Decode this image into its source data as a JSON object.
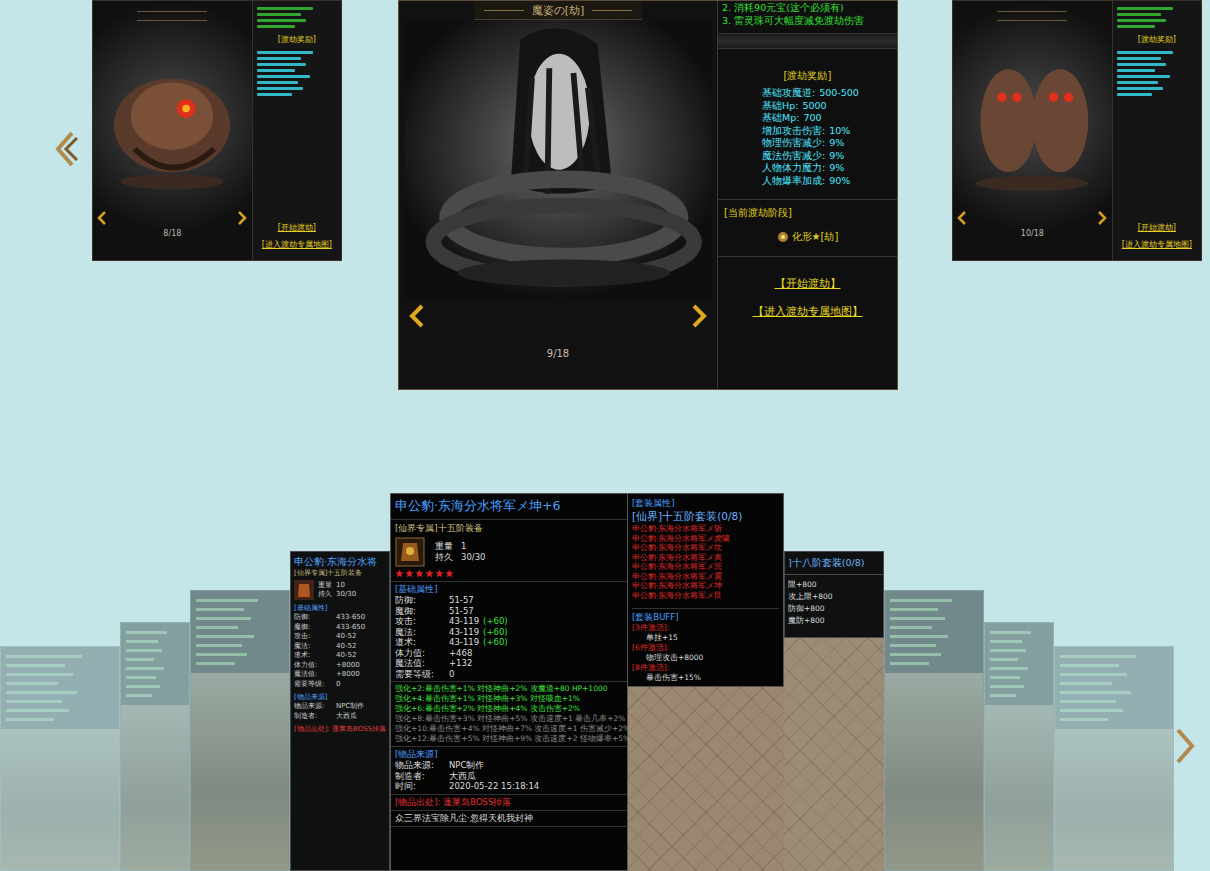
{
  "top_carousel": {
    "left_card": {
      "selected": false,
      "page": "8/18",
      "reward_title": "[渡劫奖励]",
      "buttons": [
        "[开始渡劫]",
        "[进入渡劫专属地图]"
      ]
    },
    "main_card": {
      "selected": true,
      "title": "魔姿の[劫]",
      "page": "9/18",
      "notes": [
        "2. 消耗90元宝(这个必须有)",
        "3. 雷灵珠可大幅度减免渡劫伤害"
      ],
      "reward_title": "[渡劫奖励]",
      "rewards": [
        {
          "label": "基础攻魔道:",
          "value": "500-500"
        },
        {
          "label": "基础Hp:",
          "value": "5000"
        },
        {
          "label": "基础Mp:",
          "value": "700"
        },
        {
          "label": "增加攻击伤害:",
          "value": "10%"
        },
        {
          "label": "物理伤害减少:",
          "value": "9%"
        },
        {
          "label": "魔法伤害减少:",
          "value": "9%"
        },
        {
          "label": "人物体力魔力:",
          "value": "9%"
        },
        {
          "label": "人物爆率加成:",
          "value": "90%"
        }
      ],
      "stage_title": "[当前渡劫阶段]",
      "stage": "化形★[劫]",
      "buttons": [
        "【开始渡劫】",
        "【进入渡劫专属地图】"
      ]
    },
    "right_card": {
      "selected": false,
      "page": "10/18",
      "reward_title": "[渡劫奖励]",
      "buttons": [
        "[开始渡劫]",
        "[进入渡劫专属地图]"
      ]
    }
  },
  "bottom_carousel": {
    "cards": [
      {
        "kind": "ghost",
        "selected": false
      },
      {
        "kind": "ghost",
        "selected": false
      },
      {
        "kind": "ghost",
        "selected": false
      },
      {
        "kind": "item",
        "selected": false,
        "title": "申公豹·东海分水将",
        "tier": "[仙界专属]十五阶装备",
        "meta": [
          {
            "label": "重量",
            "value": "10"
          },
          {
            "label": "持久",
            "value": "30/30"
          }
        ],
        "base_title": "[基础属性]",
        "base": [
          {
            "label": "防御:",
            "value": "433-650"
          },
          {
            "label": "魔御:",
            "value": "433-650"
          },
          {
            "label": "攻击:",
            "value": "40-52"
          },
          {
            "label": "魔法:",
            "value": "40-52"
          },
          {
            "label": "道术:",
            "value": "40-52"
          },
          {
            "label": "体力值:",
            "value": "+8000"
          },
          {
            "label": "魔法值:",
            "value": "+8000"
          },
          {
            "label": "需要等级:",
            "value": "0"
          }
        ],
        "source_title": "[物品来源]",
        "source": [
          {
            "label": "物品来源:",
            "value": "NPC制作"
          },
          {
            "label": "制造者:",
            "value": "大西瓜"
          }
        ],
        "origin": "[物品出处]: 蓬莱岛BOSS掉落"
      },
      {
        "kind": "main",
        "selected": true,
        "title": "申公豹·东海分水将军メ坤+6",
        "tier": "[仙界专属]十五阶装备",
        "meta": [
          {
            "label": "重量",
            "value": "1"
          },
          {
            "label": "持久",
            "value": "30/30"
          }
        ],
        "stars": 6,
        "base_title": "[基础属性]",
        "base": [
          {
            "label": "防御:",
            "value": "51-57"
          },
          {
            "label": "魔御:",
            "value": "51-57"
          },
          {
            "label": "攻击:",
            "value": "43-119",
            "bonus": "(+60)"
          },
          {
            "label": "魔法:",
            "value": "43-119",
            "bonus": "(+60)"
          },
          {
            "label": "道术:",
            "value": "43-119",
            "bonus": "(+60)"
          },
          {
            "label": "体力值:",
            "value": "+468"
          },
          {
            "label": "魔法值:",
            "value": "+132"
          },
          {
            "label": "需要等级:",
            "value": "0"
          }
        ],
        "enhance": [
          {
            "text": "强化+2:暴击伤害+1% 对怪神曲+2% 攻魔道+80 HP+1000",
            "active": true
          },
          {
            "text": "强化+4:暴击伤害+1% 对怪神曲+3% 对怪吸血+1%",
            "active": true
          },
          {
            "text": "强化+6:暴击伤害+2% 对怪神曲+4% 攻击伤害+2%",
            "active": true
          },
          {
            "text": "强化+8:暴击伤害+3% 对怪神曲+5% 攻击速度+1 暴击几率+2%",
            "active": false
          },
          {
            "text": "强化+10:暴击伤害+4% 对怪神曲+7% 攻击速度+1 伤害减少+2%",
            "active": false
          },
          {
            "text": "强化+12:暴击伤害+5% 对怪神曲+9% 攻击速度+2 怪物爆率+5%",
            "active": false
          }
        ],
        "source_title": "[物品来源]",
        "source": [
          {
            "label": "物品来源:",
            "value": "NPC制作"
          },
          {
            "label": "制造者:",
            "value": "大西瓜"
          },
          {
            "label": "时间:",
            "value": "2020-05-22 15:18:14"
          }
        ],
        "origin": "[物品出处]: 蓬莱岛BOSS掉落",
        "motto": "众三界法宝除凡尘·忽得天机我封神",
        "set": {
          "header": "[套装属性]",
          "title": "[仙界]十五阶套装(0/8)",
          "items": [
            "申公豹·东海分水将军メ斩",
            "申公豹·东海分水将军メ虎啸",
            "申公豹·东海分水将军メ坎",
            "申公豹·东海分水将军メ离",
            "申公豹·东海分水将军メ巽",
            "申公豹·东海分水将军メ震",
            "申公豹·东海分水将军メ坤",
            "申公豹·东海分水将军メ艮"
          ],
          "buff_title": "[套装BUFF]",
          "buffs": [
            {
              "label": "[3件激活]:",
              "value": "单挂+15"
            },
            {
              "label": "[6件激活]:",
              "value": "物理攻击+8000"
            },
            {
              "label": "[8件激活]:",
              "value": "暴击伤害+15%"
            }
          ]
        }
      },
      {
        "kind": "set-side",
        "selected": false,
        "title": "]十八阶套装(0/8)",
        "lines": [
          "限+800",
          "攻上限+800",
          "防御+800",
          "魔防+800"
        ]
      },
      {
        "kind": "ghost",
        "selected": false
      },
      {
        "kind": "ghost",
        "selected": false
      },
      {
        "kind": "ghost",
        "selected": false
      }
    ]
  }
}
